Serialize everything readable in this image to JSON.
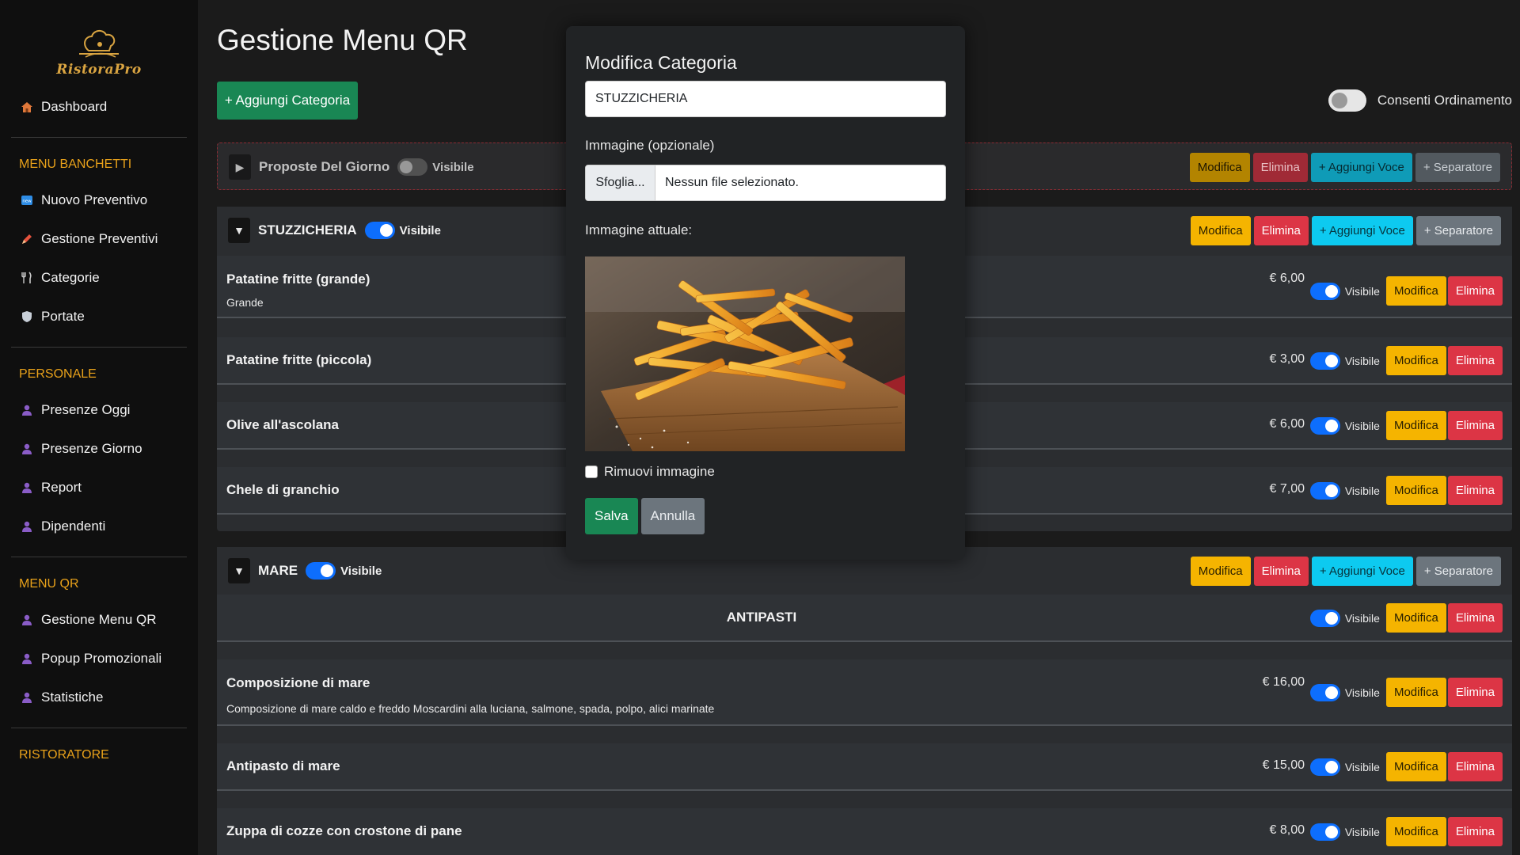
{
  "brand": {
    "name": "RistoraPro"
  },
  "sidebar": {
    "top": [
      {
        "label": "Dashboard",
        "icon": "house-icon"
      }
    ],
    "sections": [
      {
        "title": "MENU BANCHETTI",
        "items": [
          {
            "label": "Nuovo Preventivo",
            "icon": "new-badge-icon"
          },
          {
            "label": "Gestione Preventivi",
            "icon": "pencil-icon"
          },
          {
            "label": "Categorie",
            "icon": "fork-knife-icon"
          },
          {
            "label": "Portate",
            "icon": "shield-icon"
          }
        ]
      },
      {
        "title": "PERSONALE",
        "items": [
          {
            "label": "Presenze Oggi",
            "icon": "person-icon"
          },
          {
            "label": "Presenze Giorno",
            "icon": "person-icon"
          },
          {
            "label": "Report",
            "icon": "person-icon"
          },
          {
            "label": "Dipendenti",
            "icon": "person-icon"
          }
        ]
      },
      {
        "title": "MENU QR",
        "items": [
          {
            "label": "Gestione Menu QR",
            "icon": "person-icon"
          },
          {
            "label": "Popup Promozionali",
            "icon": "person-icon"
          },
          {
            "label": "Statistiche",
            "icon": "person-icon"
          }
        ]
      },
      {
        "title": "RISTORATORE",
        "items": []
      }
    ]
  },
  "main": {
    "title": "Gestione Menu QR",
    "add_category_label": "+ Aggiungi Categoria",
    "order_toggle_label": "Consenti Ordinamento"
  },
  "labels": {
    "visible": "Visibile",
    "edit": "Modifica",
    "delete": "Elimina",
    "add_item": "+ Aggiungi Voce",
    "separator": "+ Separatore"
  },
  "categories": [
    {
      "name": "Proposte Del Giorno",
      "visible": false,
      "expanded": false
    },
    {
      "name": "STUZZICHERIA",
      "visible": true,
      "expanded": true,
      "items": [
        {
          "name": "Patatine fritte (grande)",
          "desc": "Grande",
          "price": "€ 6,00",
          "visible": true
        },
        {
          "name": "Patatine fritte (piccola)",
          "desc": "",
          "price": "€ 3,00",
          "visible": true
        },
        {
          "name": "Olive all'ascolana",
          "desc": "",
          "price": "€ 6,00",
          "visible": true
        },
        {
          "name": "Chele di granchio",
          "desc": "",
          "price": "€ 7,00",
          "visible": true
        }
      ]
    },
    {
      "name": "MARE",
      "visible": true,
      "expanded": true,
      "separator": "ANTIPASTI",
      "items": [
        {
          "name": "Composizione di mare",
          "desc": "Composizione di mare caldo e freddo Moscardini alla luciana, salmone, spada, polpo, alici marinate",
          "price": "€ 16,00",
          "visible": true
        },
        {
          "name": "Antipasto di mare",
          "desc": "",
          "price": "€ 15,00",
          "visible": true
        },
        {
          "name": "Zuppa di cozze con crostone di pane",
          "desc": "",
          "price": "€ 8,00",
          "visible": true
        }
      ]
    }
  ],
  "modal": {
    "title": "Modifica Categoria",
    "name_value": "STUZZICHERIA",
    "image_label": "Immagine (opzionale)",
    "browse_label": "Sfoglia...",
    "no_file_label": "Nessun file selezionato.",
    "current_image_label": "Immagine attuale:",
    "remove_image_label": "Rimuovi immagine",
    "save_label": "Salva",
    "cancel_label": "Annulla"
  },
  "colors": {
    "success": "#198754",
    "warning": "#f5b400",
    "danger": "#dc3545",
    "info": "#0dcaf0",
    "secondary": "#6c757d",
    "accent": "#e8a11a"
  }
}
